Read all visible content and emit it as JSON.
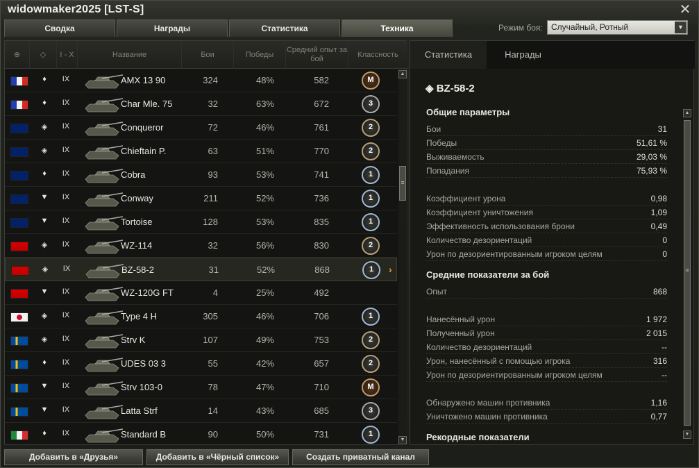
{
  "window": {
    "title": "widowmaker2025 [LST-S]",
    "close_icon": "close-icon"
  },
  "tabs": [
    "Сводка",
    "Награды",
    "Статистика",
    "Техника"
  ],
  "active_tab": 3,
  "mode": {
    "label": "Режим боя:",
    "value": "Случайный, Ротный"
  },
  "table": {
    "headers": {
      "nation": "globe-icon",
      "type": "tank-type-icon",
      "tier": "I - X",
      "name": "Название",
      "battles": "Бои",
      "wins": "Победы",
      "avg_exp": "Средний опыт за бой",
      "mastery": "Классность"
    },
    "rows": [
      {
        "nation": "fr",
        "type": "♦",
        "tier": "IX",
        "name": "AMX 13 90",
        "battles": "324",
        "wins": "48%",
        "exp": "582",
        "mastery": "M"
      },
      {
        "nation": "fr",
        "type": "♦",
        "tier": "IX",
        "name": "Char Mle. 75",
        "battles": "32",
        "wins": "63%",
        "exp": "672",
        "mastery": "3"
      },
      {
        "nation": "uk",
        "type": "◈",
        "tier": "IX",
        "name": "Conqueror",
        "battles": "72",
        "wins": "46%",
        "exp": "761",
        "mastery": "2"
      },
      {
        "nation": "uk",
        "type": "◈",
        "tier": "IX",
        "name": "Chieftain P.",
        "battles": "63",
        "wins": "51%",
        "exp": "770",
        "mastery": "2"
      },
      {
        "nation": "uk",
        "type": "♦",
        "tier": "IX",
        "name": "Cobra",
        "battles": "93",
        "wins": "53%",
        "exp": "741",
        "mastery": "1"
      },
      {
        "nation": "uk",
        "type": "▼",
        "tier": "IX",
        "name": "Conway",
        "battles": "211",
        "wins": "52%",
        "exp": "736",
        "mastery": "1"
      },
      {
        "nation": "uk",
        "type": "▼",
        "tier": "IX",
        "name": "Tortoise",
        "battles": "128",
        "wins": "53%",
        "exp": "835",
        "mastery": "1"
      },
      {
        "nation": "cn",
        "type": "◈",
        "tier": "IX",
        "name": "WZ-114",
        "battles": "32",
        "wins": "56%",
        "exp": "830",
        "mastery": "2"
      },
      {
        "nation": "cn",
        "type": "◈",
        "tier": "IX",
        "name": "BZ-58-2",
        "battles": "31",
        "wins": "52%",
        "exp": "868",
        "mastery": "1",
        "selected": true
      },
      {
        "nation": "cn",
        "type": "▼",
        "tier": "IX",
        "name": "WZ-120G FT",
        "battles": "4",
        "wins": "25%",
        "exp": "492",
        "mastery": ""
      },
      {
        "nation": "jp",
        "type": "◈",
        "tier": "IX",
        "name": "Type 4 H",
        "battles": "305",
        "wins": "46%",
        "exp": "706",
        "mastery": "1"
      },
      {
        "nation": "se",
        "type": "◈",
        "tier": "IX",
        "name": "Strv K",
        "battles": "107",
        "wins": "49%",
        "exp": "753",
        "mastery": "2"
      },
      {
        "nation": "se",
        "type": "♦",
        "tier": "IX",
        "name": "UDES 03 3",
        "battles": "55",
        "wins": "42%",
        "exp": "657",
        "mastery": "2"
      },
      {
        "nation": "se",
        "type": "▼",
        "tier": "IX",
        "name": "Strv 103-0",
        "battles": "78",
        "wins": "47%",
        "exp": "710",
        "mastery": "M"
      },
      {
        "nation": "se",
        "type": "▼",
        "tier": "IX",
        "name": "Latta Strf",
        "battles": "14",
        "wins": "43%",
        "exp": "685",
        "mastery": "3"
      },
      {
        "nation": "it",
        "type": "♦",
        "tier": "IX",
        "name": "Standard B",
        "battles": "90",
        "wins": "50%",
        "exp": "731",
        "mastery": "1"
      }
    ]
  },
  "detail": {
    "tabs": [
      "Статистика",
      "Награды"
    ],
    "vehicle_name": "BZ-58-2",
    "sections": [
      {
        "heading": "Общие параметры",
        "rows": [
          {
            "label": "Бои",
            "value": "31"
          },
          {
            "label": "Победы",
            "value": "51,61 %"
          },
          {
            "label": "Выживаемость",
            "value": "29,03 %"
          },
          {
            "label": "Попадания",
            "value": "75,93 %"
          },
          {
            "label": "",
            "value": ""
          },
          {
            "label": "Коэффициент урона",
            "value": "0,98"
          },
          {
            "label": "Коэффициент уничтожения",
            "value": "1,09"
          },
          {
            "label": "Эффективность использования брони",
            "value": "0,49"
          },
          {
            "label": "Количество дезориентаций",
            "value": "0"
          },
          {
            "label": "Урон по дезориентированным игроком целям",
            "value": "0"
          }
        ]
      },
      {
        "heading": "Средние показатели за бой",
        "rows": [
          {
            "label": "Опыт",
            "value": "868"
          },
          {
            "label": "",
            "value": ""
          },
          {
            "label": "Нанесённый урон",
            "value": "1 972"
          },
          {
            "label": "Полученный урон",
            "value": "2 015"
          },
          {
            "label": "Количество дезориентаций",
            "value": "--"
          },
          {
            "label": "Урон, нанесённый с помощью игрока",
            "value": "316"
          },
          {
            "label": "Урон по дезориентированным игроком целям",
            "value": "--"
          },
          {
            "label": "",
            "value": ""
          },
          {
            "label": "Обнаружено машин противника",
            "value": "1,16"
          },
          {
            "label": "Уничтожено машин противника",
            "value": "0,77"
          }
        ]
      },
      {
        "heading": "Рекордные показатели",
        "rows": []
      }
    ]
  },
  "buttons": [
    "Добавить в «Друзья»",
    "Добавить в «Чёрный список»",
    "Создать приватный канал"
  ]
}
